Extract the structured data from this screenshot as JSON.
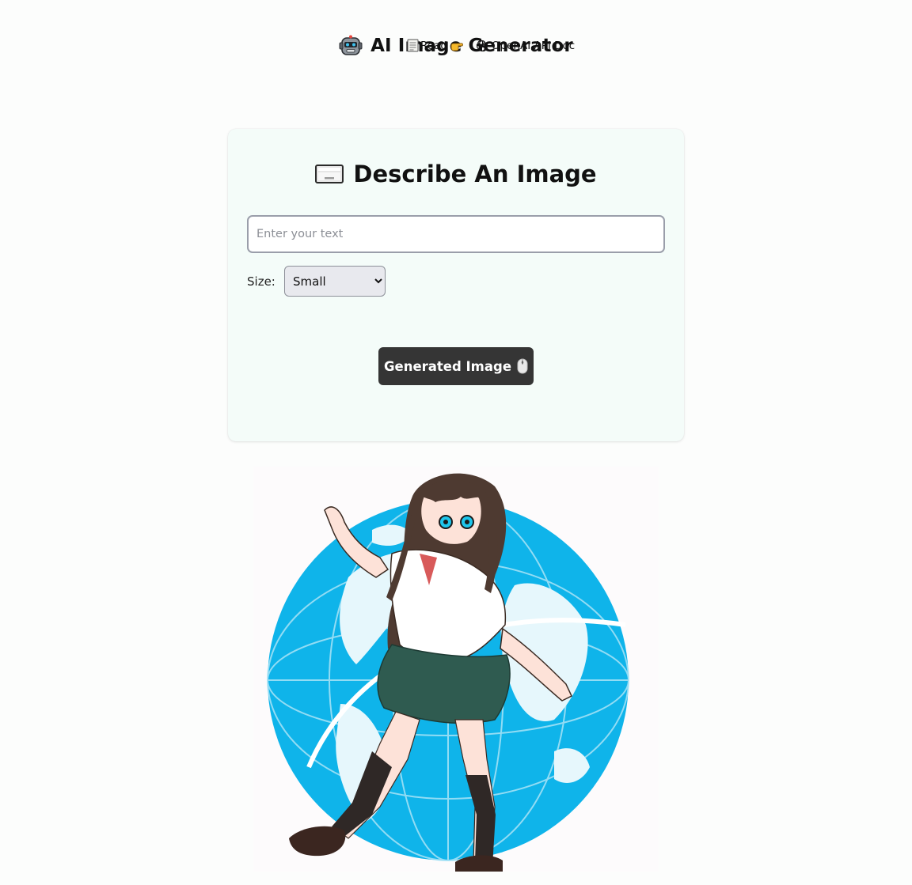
{
  "header": {
    "title": "AI Image Generator",
    "title_icon": "robot-icon",
    "links": [
      {
        "label": "Read",
        "icon": "page-icon",
        "trailing_icon": "pointing-hand-icon"
      },
      {
        "label": "OpenAI API Doc",
        "icon": "openai-logo-icon"
      }
    ]
  },
  "form": {
    "title": "Describe An Image",
    "title_icon": "keyboard-icon",
    "prompt": {
      "placeholder": "Enter your text",
      "value": ""
    },
    "size": {
      "label": "Size:",
      "selected": "Small"
    },
    "submit": {
      "label": "Generated Image",
      "icon": "mouse-icon"
    }
  },
  "result": {
    "image_alt": "",
    "colors": {
      "globe": "#0fb4ea",
      "globe_land": "#e6f7fc",
      "skirt": "#2f5b50",
      "hair": "#4e3a31"
    }
  },
  "colors": {
    "page_bg": "#fcfdfc",
    "card_bg": "#f4fcf9",
    "button_bg": "#353535",
    "button_text": "#ffffff",
    "input_border": "#9a9eaa"
  }
}
